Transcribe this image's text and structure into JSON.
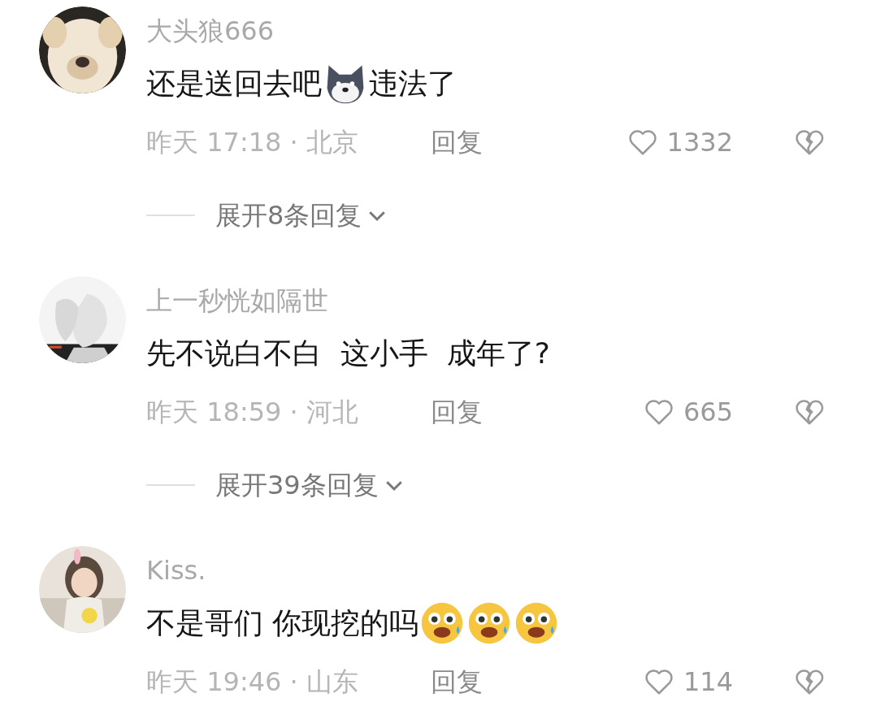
{
  "comments": [
    {
      "avatar": {
        "kind": "picture"
      },
      "username": "大头狼666",
      "content": [
        {
          "kind": "text",
          "text": "还是送回去吧"
        },
        {
          "kind": "dog"
        },
        {
          "kind": "text",
          "text": "违法了"
        }
      ],
      "meta": "昨天 17:18 · 北京",
      "reply": "回复",
      "likes": "1332",
      "expand": "展开8条回复"
    },
    {
      "avatar": {
        "kind": "picture"
      },
      "username": "上一秒恍如隔世",
      "content": [
        {
          "kind": "text",
          "text": "先不说白不白  这小手  成年了?"
        }
      ],
      "meta": "昨天 18:59 · 河北",
      "reply": "回复",
      "likes": "665",
      "expand": "展开39条回复"
    },
    {
      "avatar": {
        "kind": "picture"
      },
      "username": "Kiss.",
      "content": [
        {
          "kind": "text",
          "text": "不是哥们 你现挖的吗"
        },
        {
          "kind": "fear"
        },
        {
          "kind": "fear"
        },
        {
          "kind": "fear"
        }
      ],
      "meta": "昨天 19:46 · 山东",
      "reply": "回复",
      "likes": "114"
    }
  ]
}
